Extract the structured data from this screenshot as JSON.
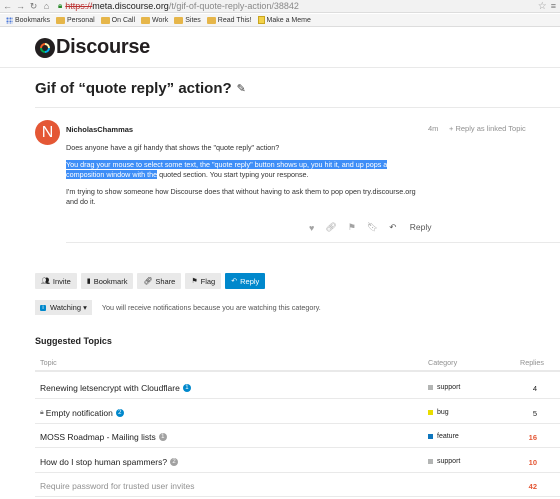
{
  "browser": {
    "url_scheme": "https://",
    "url_host": "meta.discourse.org",
    "url_path": "/t/gif-of-quote-reply-action/38842",
    "bookmarks": [
      "Bookmarks",
      "Personal",
      "On Call",
      "Work",
      "Sites",
      "Read This!",
      "Make a Meme"
    ]
  },
  "site": {
    "logo_text": "Discourse"
  },
  "topic": {
    "title": "Gif of “quote reply” action?"
  },
  "post": {
    "avatar_letter": "N",
    "username": "NicholasChammas",
    "age": "4m",
    "reply_as_linked": "Reply as linked Topic",
    "p1": "Does anyone have a gif handy that shows the \"quote reply\" action?",
    "p2_highlight_line1": "You drag your mouse to select some text, the \"quote reply\" button shows up, you hit it, and up pops a",
    "p2_highlight_line2": "composition window with the",
    "p2_rest": " quoted section. You start typing your response.",
    "p3": "I'm trying to show someone how Discourse does that without having to ask them to pop open try.discourse.org and do it.",
    "reply_label": "Reply"
  },
  "footer": {
    "invite": "Invite",
    "bookmark": "Bookmark",
    "share": "Share",
    "flag": "Flag",
    "reply": "Reply",
    "watching": "Watching",
    "watching_text": "You will receive notifications because you are watching this category."
  },
  "suggested": {
    "title": "Suggested Topics",
    "headers": {
      "topic": "Topic",
      "category": "Category",
      "replies": "Replies"
    },
    "rows": [
      {
        "title": "Renewing letsencrypt with Cloudflare",
        "badge": "1",
        "category": "support",
        "cat_color": "#b3b5b4",
        "replies": "4",
        "reply_color": "#222222"
      },
      {
        "title": "Empty notification",
        "badge": "2",
        "category": "bug",
        "cat_color": "#e9dd00",
        "replies": "5",
        "reply_color": "#222222"
      },
      {
        "title": "MOSS Roadmap - Mailing lists",
        "badge": "1",
        "category": "feature",
        "cat_color": "#0e76bd",
        "replies": "16",
        "reply_color": "#e45735"
      },
      {
        "title": "How do I stop human spammers?",
        "badge": "2",
        "category": "support",
        "cat_color": "#b3b5b4",
        "replies": "10",
        "reply_color": "#e45735"
      },
      {
        "title": "Require password for trusted user invites",
        "badge": "",
        "category": "",
        "cat_color": "",
        "replies": "42",
        "reply_color": "#e45735"
      }
    ]
  }
}
